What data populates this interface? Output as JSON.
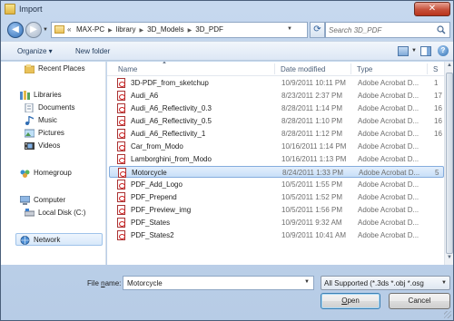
{
  "window": {
    "title": "Import",
    "close_symbol": "✕"
  },
  "navigation": {
    "back_symbol": "◀",
    "forward_symbol": "▶",
    "overflow_symbol": "«",
    "breadcrumbs": [
      "MAX-PC",
      "library",
      "3D_Models",
      "3D_PDF"
    ],
    "search_placeholder": "Search 3D_PDF"
  },
  "toolbar": {
    "organize_label": "Organize ▾",
    "new_folder_label": "New folder",
    "help_symbol": "?"
  },
  "sidebar": {
    "items": [
      {
        "label": "Recent Places",
        "icon": "recent-places-icon"
      },
      {
        "label": "Libraries",
        "icon": "libraries-icon"
      },
      {
        "label": "Documents",
        "icon": "documents-icon"
      },
      {
        "label": "Music",
        "icon": "music-icon"
      },
      {
        "label": "Pictures",
        "icon": "pictures-icon"
      },
      {
        "label": "Videos",
        "icon": "videos-icon"
      },
      {
        "label": "Homegroup",
        "icon": "homegroup-icon"
      },
      {
        "label": "Computer",
        "icon": "computer-icon"
      },
      {
        "label": "Local Disk (C:)",
        "icon": "local-disk-icon"
      },
      {
        "label": "Network",
        "icon": "network-icon"
      }
    ]
  },
  "file_list": {
    "columns": [
      "Name",
      "Date modified",
      "Type",
      "S"
    ],
    "rows": [
      {
        "name": "3D-PDF_from_sketchup",
        "date": "10/9/2011 10:11 PM",
        "type": "Adobe Acrobat D...",
        "size": "1"
      },
      {
        "name": "Audi_A6",
        "date": "8/23/2011 2:37 PM",
        "type": "Adobe Acrobat D...",
        "size": "17"
      },
      {
        "name": "Audi_A6_Reflectivity_0.3",
        "date": "8/28/2011 1:14 PM",
        "type": "Adobe Acrobat D...",
        "size": "16"
      },
      {
        "name": "Audi_A6_Reflectivity_0.5",
        "date": "8/28/2011 1:10 PM",
        "type": "Adobe Acrobat D...",
        "size": "16"
      },
      {
        "name": "Audi_A6_Reflectivity_1",
        "date": "8/28/2011 1:12 PM",
        "type": "Adobe Acrobat D...",
        "size": "16"
      },
      {
        "name": "Car_from_Modo",
        "date": "10/16/2011 1:14 PM",
        "type": "Adobe Acrobat D...",
        "size": ""
      },
      {
        "name": "Lamborghini_from_Modo",
        "date": "10/16/2011 1:13 PM",
        "type": "Adobe Acrobat D...",
        "size": ""
      },
      {
        "name": "Motorcycle",
        "date": "8/24/2011 1:33 PM",
        "type": "Adobe Acrobat D...",
        "size": "5"
      },
      {
        "name": "PDF_Add_Logo",
        "date": "10/5/2011 1:55 PM",
        "type": "Adobe Acrobat D...",
        "size": ""
      },
      {
        "name": "PDF_Prepend",
        "date": "10/5/2011 1:52 PM",
        "type": "Adobe Acrobat D...",
        "size": ""
      },
      {
        "name": "PDF_Preview_img",
        "date": "10/5/2011 1:56 PM",
        "type": "Adobe Acrobat D...",
        "size": ""
      },
      {
        "name": "PDF_States",
        "date": "10/9/2011 9:32 AM",
        "type": "Adobe Acrobat D...",
        "size": ""
      },
      {
        "name": "PDF_States2",
        "date": "10/9/2011 10:41 AM",
        "type": "Adobe Acrobat D...",
        "size": ""
      }
    ],
    "selected_index": 7
  },
  "footer": {
    "filename_label_pre": "File ",
    "filename_label_u": "n",
    "filename_label_post": "ame:",
    "filename_value": "Motorcycle",
    "filter_value": "All Supported (*.3ds *.obj *.osg",
    "open_label_u": "O",
    "open_label_rest": "pen",
    "cancel_label": "Cancel"
  },
  "colors": {
    "accent": "#3c7fb1",
    "selection": "#c8dff8",
    "pdf_red": "#cc2222"
  }
}
